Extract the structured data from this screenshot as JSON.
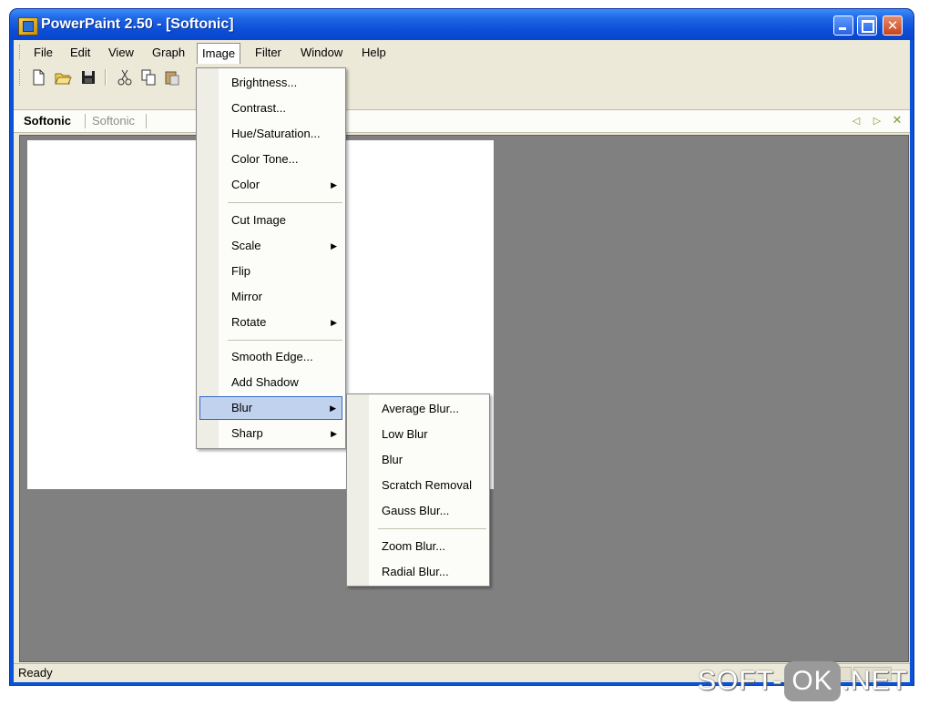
{
  "window": {
    "title": "PowerPaint 2.50 - [Softonic]",
    "close_glyph": "✕"
  },
  "menubar": {
    "items": [
      "File",
      "Edit",
      "View",
      "Graph",
      "Image",
      "Filter",
      "Window",
      "Help"
    ],
    "active": "Image"
  },
  "toolbar": {
    "buttons": [
      "new-icon",
      "open-icon",
      "save-icon",
      "cut-icon",
      "copy-icon",
      "paste-icon"
    ]
  },
  "doc_tabs": {
    "tabs": [
      "Softonic",
      "Softonic"
    ],
    "nav_prev": "◁",
    "nav_next": "▷",
    "close": "✕"
  },
  "image_menu": {
    "items": [
      "Brightness...",
      "Contrast...",
      "Hue/Saturation...",
      "Color Tone...",
      "Color",
      "Cut Image",
      "Scale",
      "Flip",
      "Mirror",
      "Rotate",
      "Smooth Edge...",
      "Add Shadow",
      "Blur",
      "Sharp"
    ],
    "highlighted": "Blur",
    "submenu_arrow": "▶"
  },
  "blur_submenu": {
    "items": [
      "Average Blur...",
      "Low Blur",
      "Blur",
      "Scratch Removal",
      "Gauss Blur...",
      "Zoom Blur...",
      "Radial Blur..."
    ]
  },
  "status": {
    "text": "Ready"
  },
  "watermark": {
    "left": "SOFT-",
    "mid": "OK",
    "right": ".NET"
  },
  "colors": {
    "title_bar": "#0a52d6",
    "workspace": "#808080",
    "menu_highlight": "#c1d2ee",
    "menu_highlight_border": "#316ac5",
    "chrome": "#ece9d8"
  }
}
